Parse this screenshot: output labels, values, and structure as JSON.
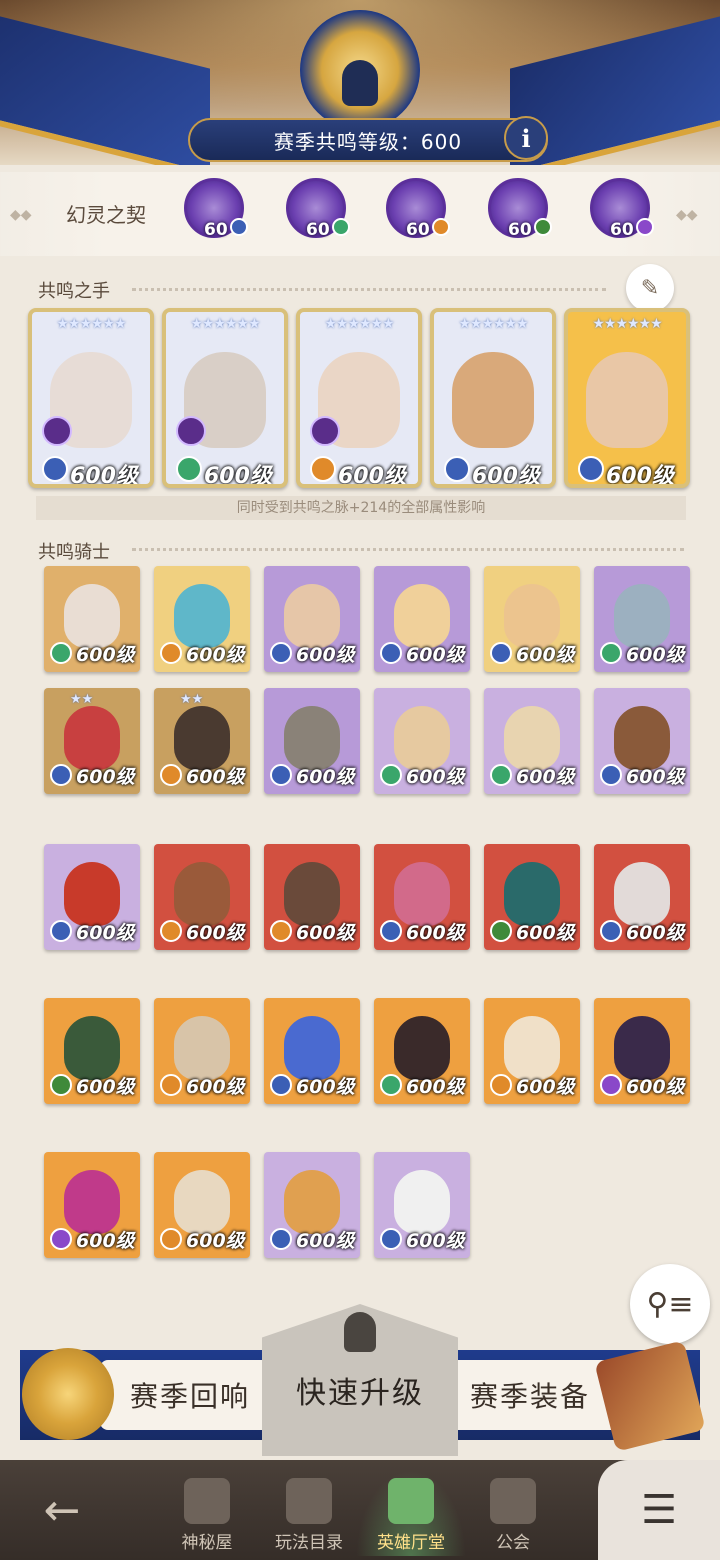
{
  "header": {
    "resonance_label": "赛季共鸣等级：600",
    "info_label": "i"
  },
  "pact": {
    "label": "幻灵之契",
    "spirits": [
      {
        "level": "60",
        "element_color": "#3b5fb5"
      },
      {
        "level": "60",
        "element_color": "#3aa66b"
      },
      {
        "level": "60",
        "element_color": "#e08a2a"
      },
      {
        "level": "60",
        "element_color": "#3f8a3a"
      },
      {
        "level": "60",
        "element_color": "#8a48c9"
      }
    ]
  },
  "hand": {
    "title": "共鸣之手",
    "cards": [
      {
        "level": "600级",
        "stars": "★★★★★★",
        "element_color": "#3b5fb5",
        "frame": "#e6e9f5",
        "face": "#e7dcd6",
        "class": true
      },
      {
        "level": "600级",
        "stars": "★★★★★★",
        "element_color": "#3aa66b",
        "frame": "#e6e9f5",
        "face": "#d9cfc7",
        "class": true
      },
      {
        "level": "600级",
        "stars": "★★★★★★",
        "element_color": "#e08a2a",
        "frame": "#e6e9f5",
        "face": "#ead6c6",
        "class": true
      },
      {
        "level": "600级",
        "stars": "★★★★★★",
        "element_color": "#3b5fb5",
        "frame": "#e6e9f5",
        "face": "#d9a97a",
        "class": false
      },
      {
        "level": "600级",
        "stars": "★★★★★★",
        "element_color": "#3b5fb5",
        "frame": "#f5c04a",
        "face": "#e9c7a6",
        "class": false
      }
    ],
    "note": "同时受到共鸣之脉+214的全部属性影响"
  },
  "knights": {
    "title": "共鸣骑士",
    "items": [
      {
        "level": "600级",
        "bg": "#e0b06b",
        "face": "#e9ddd3",
        "element_color": "#3aa66b",
        "stars": ""
      },
      {
        "level": "600级",
        "bg": "#f0d080",
        "face": "#5fb7c9",
        "element_color": "#e08a2a",
        "stars": ""
      },
      {
        "level": "600级",
        "bg": "#b79ad8",
        "face": "#e6c6a8",
        "element_color": "#3b5fb5",
        "stars": ""
      },
      {
        "level": "600级",
        "bg": "#b79ad8",
        "face": "#f0d09a",
        "element_color": "#3b5fb5",
        "stars": ""
      },
      {
        "level": "600级",
        "bg": "#f0d080",
        "face": "#ecc48e",
        "element_color": "#3b5fb5",
        "stars": ""
      },
      {
        "level": "600级",
        "bg": "#b79ad8",
        "face": "#9cb0c0",
        "element_color": "#3aa66b",
        "stars": ""
      },
      {
        "level": "600级",
        "bg": "#c8a060",
        "face": "#c84040",
        "element_color": "#3b5fb5",
        "stars": "★★"
      },
      {
        "level": "600级",
        "bg": "#c8a060",
        "face": "#4a3a30",
        "element_color": "#e08a2a",
        "stars": "★★"
      },
      {
        "level": "600级",
        "bg": "#b79ad8",
        "face": "#8a8278",
        "element_color": "#3b5fb5",
        "stars": ""
      },
      {
        "level": "600级",
        "bg": "#c9b0e0",
        "face": "#e6c9a0",
        "element_color": "#3aa66b",
        "stars": ""
      },
      {
        "level": "600级",
        "bg": "#c9b0e0",
        "face": "#e8d4b0",
        "element_color": "#3aa66b",
        "stars": ""
      },
      {
        "level": "600级",
        "bg": "#c9b0e0",
        "face": "#8a5a3a",
        "element_color": "#3b5fb5",
        "stars": ""
      },
      {
        "level": "600级",
        "bg": "#c9b0e0",
        "face": "#c83a2a",
        "element_color": "#3b5fb5",
        "stars": ""
      },
      {
        "level": "600级",
        "bg": "#d25040",
        "face": "#9a5a3a",
        "element_color": "#e08a2a",
        "stars": ""
      },
      {
        "level": "600级",
        "bg": "#d25040",
        "face": "#6a4a3a",
        "element_color": "#e08a2a",
        "stars": ""
      },
      {
        "level": "600级",
        "bg": "#d25040",
        "face": "#d26a8a",
        "element_color": "#3b5fb5",
        "stars": ""
      },
      {
        "level": "600级",
        "bg": "#d25040",
        "face": "#2a6a6a",
        "element_color": "#3f8a3a",
        "stars": ""
      },
      {
        "level": "600级",
        "bg": "#d25040",
        "face": "#e2dad8",
        "element_color": "#3b5fb5",
        "stars": ""
      },
      {
        "level": "600级",
        "bg": "#eea040",
        "face": "#3a5a3a",
        "element_color": "#3f8a3a",
        "stars": ""
      },
      {
        "level": "600级",
        "bg": "#eea040",
        "face": "#d8c4a8",
        "element_color": "#e08a2a",
        "stars": ""
      },
      {
        "level": "600级",
        "bg": "#eea040",
        "face": "#4a6ad0",
        "element_color": "#3b5fb5",
        "stars": ""
      },
      {
        "level": "600级",
        "bg": "#eea040",
        "face": "#3a2a2a",
        "element_color": "#3aa66b",
        "stars": ""
      },
      {
        "level": "600级",
        "bg": "#eea040",
        "face": "#f0e0c8",
        "element_color": "#e08a2a",
        "stars": ""
      },
      {
        "level": "600级",
        "bg": "#eea040",
        "face": "#3a2a4a",
        "element_color": "#8a48c9",
        "stars": ""
      },
      {
        "level": "600级",
        "bg": "#eea040",
        "face": "#c03a8a",
        "element_color": "#8a48c9",
        "stars": ""
      },
      {
        "level": "600级",
        "bg": "#eea040",
        "face": "#e8d8c0",
        "element_color": "#e08a2a",
        "stars": ""
      },
      {
        "level": "600级",
        "bg": "#c9b0e0",
        "face": "#e0a050",
        "element_color": "#3b5fb5",
        "stars": ""
      },
      {
        "level": "600级",
        "bg": "#c9b0e0",
        "face": "#f0f0f0",
        "element_color": "#3b5fb5",
        "stars": ""
      }
    ]
  },
  "actions": {
    "echo_label": "赛季回响",
    "quick_label": "快速升级",
    "gear_label": "赛季装备"
  },
  "nav": {
    "back_icon": "arrow-left-icon",
    "items": [
      {
        "label": "神秘屋",
        "icon": "house-icon",
        "active": false
      },
      {
        "label": "玩法目录",
        "icon": "diamond-grid-icon",
        "active": false
      },
      {
        "label": "英雄厅堂",
        "icon": "knight-helmet-icon",
        "active": true
      },
      {
        "label": "公会",
        "icon": "crossed-swords-icon",
        "active": false
      }
    ],
    "menu_icon": "menu-list-icon"
  },
  "icons": {
    "filter": "filter-icon",
    "quill": "quill-icon",
    "info": "info-icon"
  }
}
